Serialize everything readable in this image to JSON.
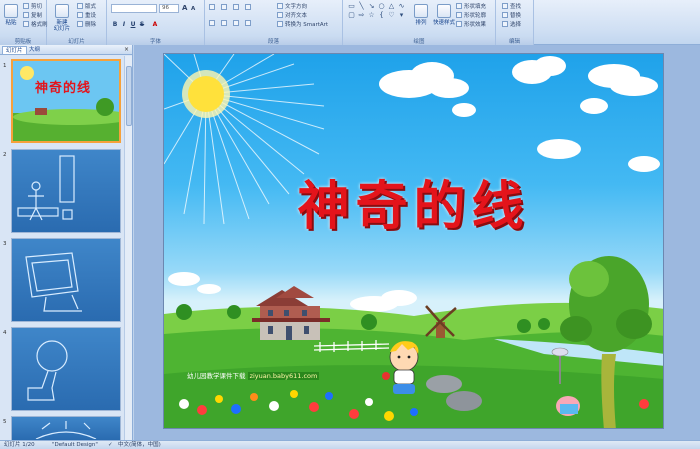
{
  "ribbon": {
    "clipboard": {
      "label": "剪贴板",
      "paste": "粘贴",
      "cut": "剪切",
      "copy": "复制",
      "format_painter": "格式刷"
    },
    "slides": {
      "label": "幻灯片",
      "new_slide": "新建\n幻灯片",
      "layout": "版式",
      "reset": "重设",
      "delete": "删除"
    },
    "font": {
      "label": "字体",
      "font_size": "96"
    },
    "paragraph": {
      "label": "段落",
      "text_direction": "文字方向",
      "align_text": "对齐文本",
      "smartart": "转换为 SmartArt"
    },
    "drawing": {
      "label": "绘图",
      "arrange": "排列",
      "quick_styles": "快速样式",
      "shape_fill": "形状填充",
      "shape_outline": "形状轮廓",
      "shape_effects": "形状效果"
    },
    "editing": {
      "label": "编辑",
      "find": "查找",
      "replace": "替换",
      "select": "选择"
    }
  },
  "pane": {
    "tab_slides": "幻灯片",
    "tab_outline": "大纲",
    "thumbnails": [
      {
        "num": "1",
        "title": "神奇的线"
      },
      {
        "num": "2"
      },
      {
        "num": "3"
      },
      {
        "num": "4"
      },
      {
        "num": "5"
      }
    ]
  },
  "slide": {
    "title": "神奇的线",
    "caption_prefix": "幼儿园教学课件下载",
    "caption_url": "ziyuan.baby611.com"
  },
  "status": {
    "slide_of": "幻灯片 1/20",
    "theme": "\"Default Design\"",
    "language": "中文(简体，中国)"
  },
  "colors": {
    "title_red": "#e4141b",
    "sky": "#1fa2ea",
    "grass": "#3fa52b",
    "selected_thumb_border": "#f6a13a"
  }
}
